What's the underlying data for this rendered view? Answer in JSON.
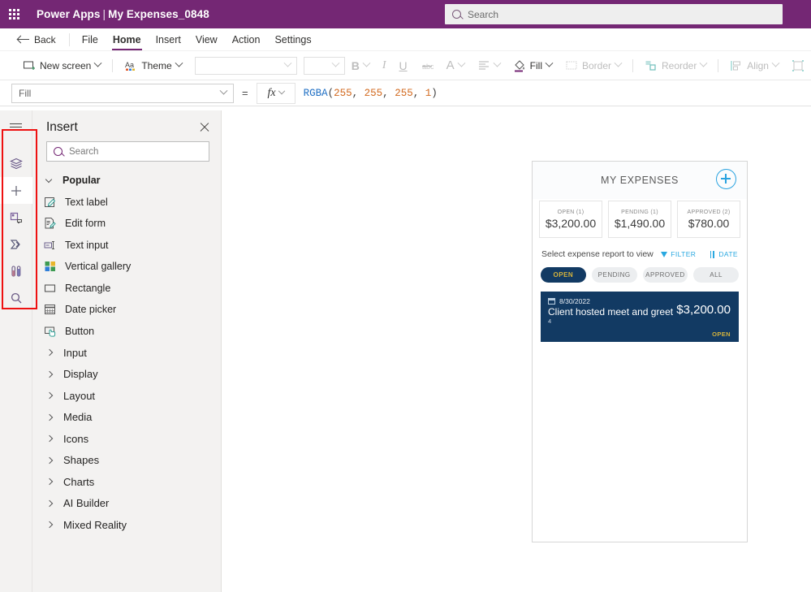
{
  "topbar": {
    "waffle_icon": "waffle-grid-icon",
    "product": "Power Apps",
    "separator": "|",
    "app_name": "My Expenses_0848",
    "search_placeholder": "Search",
    "search_icon": "search-icon",
    "background_color": "#742774"
  },
  "menubar": {
    "back_label": "Back",
    "back_icon": "arrow-left-icon",
    "items": [
      {
        "label": "File",
        "active": false
      },
      {
        "label": "Home",
        "active": true
      },
      {
        "label": "Insert",
        "active": false
      },
      {
        "label": "View",
        "active": false
      },
      {
        "label": "Action",
        "active": false
      },
      {
        "label": "Settings",
        "active": false
      }
    ],
    "accent_color": "#742774"
  },
  "ribbon": {
    "new_screen_label": "New screen",
    "new_screen_icon": "new-screen-icon",
    "theme_label": "Theme",
    "theme_icon": "theme-icon",
    "font_family_value": "",
    "font_size_value": "",
    "bold_label": "B",
    "italic_label": "I",
    "underline_label": "U",
    "strikethrough_icon": "strikethrough-icon",
    "font_color_label": "A",
    "align_icon": "align-text-icon",
    "fill_label": "Fill",
    "fill_icon": "paint-bucket-icon",
    "border_label": "Border",
    "border_icon": "border-icon",
    "reorder_label": "Reorder",
    "reorder_icon": "reorder-icon",
    "align_label": "Align",
    "align_group_icon": "align-objects-icon",
    "group_icon": "group-icon"
  },
  "formulabar": {
    "property": "Fill",
    "equals": "=",
    "fx_label": "fx",
    "formula_fn": "RGBA",
    "formula_open": "(",
    "formula_args": [
      "255",
      "255",
      "255",
      "1"
    ],
    "formula_close": ")",
    "formula_full": "RGBA(255, 255, 255, 1)"
  },
  "rail": {
    "menu_icon": "hamburger-icon",
    "items": [
      {
        "name": "tree-view-icon",
        "label": "Tree view",
        "selected": false
      },
      {
        "name": "insert-icon",
        "label": "Insert",
        "selected": true
      },
      {
        "name": "data-icon",
        "label": "Data",
        "selected": false
      },
      {
        "name": "power-automate-icon",
        "label": "Power Automate",
        "selected": false
      },
      {
        "name": "variables-icon",
        "label": "Variables",
        "selected": false
      },
      {
        "name": "search-icon",
        "label": "Search",
        "selected": false
      }
    ],
    "annotation_color": "#ee1111"
  },
  "insert_panel": {
    "title": "Insert",
    "close_icon": "close-icon",
    "search_placeholder": "Search",
    "search_icon": "search-icon",
    "popular_group": "Popular",
    "popular_items": [
      {
        "label": "Text label",
        "icon": "text-label-icon"
      },
      {
        "label": "Edit form",
        "icon": "edit-form-icon"
      },
      {
        "label": "Text input",
        "icon": "text-input-icon"
      },
      {
        "label": "Vertical gallery",
        "icon": "vertical-gallery-icon"
      },
      {
        "label": "Rectangle",
        "icon": "rectangle-icon"
      },
      {
        "label": "Date picker",
        "icon": "date-picker-icon"
      },
      {
        "label": "Button",
        "icon": "button-icon"
      }
    ],
    "categories": [
      {
        "label": "Input"
      },
      {
        "label": "Display"
      },
      {
        "label": "Layout"
      },
      {
        "label": "Media"
      },
      {
        "label": "Icons"
      },
      {
        "label": "Shapes"
      },
      {
        "label": "Charts"
      },
      {
        "label": "AI Builder"
      },
      {
        "label": "Mixed Reality"
      }
    ]
  },
  "app": {
    "header_title": "MY EXPENSES",
    "add_icon": "plus-circle-icon",
    "accent_color": "#29a8e0",
    "navy_color": "#123a63",
    "gold_color": "#d4b33c",
    "stats": [
      {
        "label": "OPEN (1)",
        "value": "$3,200.00"
      },
      {
        "label": "PENDING (1)",
        "value": "$1,490.00"
      },
      {
        "label": "APPROVED (2)",
        "value": "$780.00"
      }
    ],
    "select_text": "Select expense report to view",
    "filter_label": "FILTER",
    "filter_icon": "funnel-icon",
    "date_label": "DATE",
    "date_icon": "sort-icon",
    "tabs": [
      {
        "label": "OPEN",
        "active": true
      },
      {
        "label": "PENDING",
        "active": false
      },
      {
        "label": "APPROVED",
        "active": false
      },
      {
        "label": "ALL",
        "active": false
      }
    ],
    "expenses": [
      {
        "date": "8/30/2022",
        "date_icon": "calendar-icon",
        "title": "Client hosted meet and greet",
        "subtitle": "4",
        "amount": "$3,200.00",
        "status": "OPEN"
      }
    ]
  }
}
